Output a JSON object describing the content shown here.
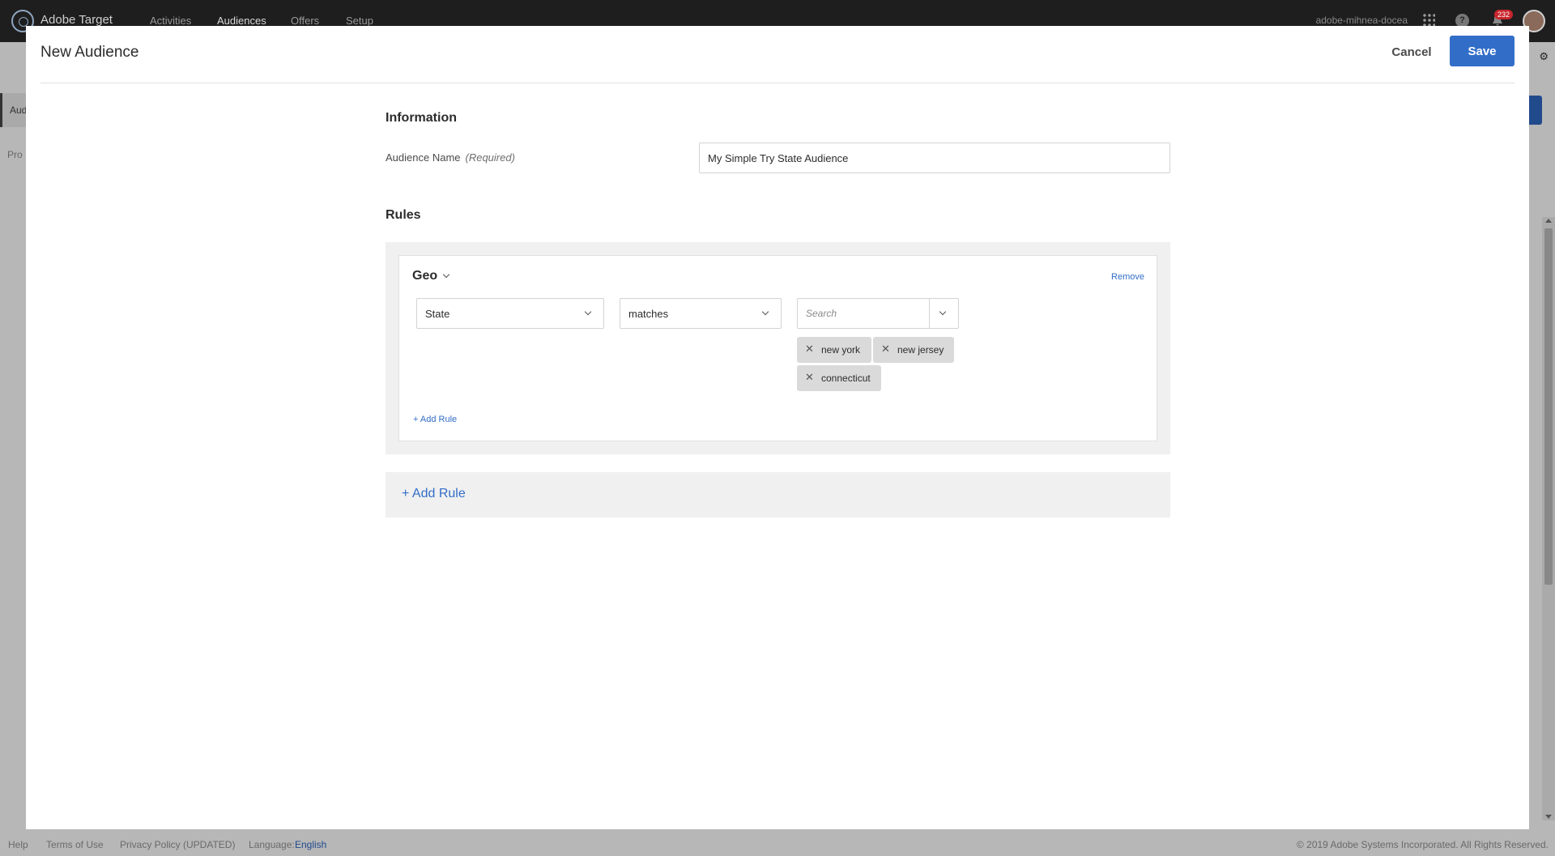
{
  "app": {
    "brand": "Adobe Target",
    "nav": [
      "Activities",
      "Audiences",
      "Offers",
      "Setup"
    ],
    "user": "adobe-mihnea-docea",
    "notification_count": "232",
    "side_items": [
      "Aud",
      "Pro"
    ]
  },
  "modal": {
    "title": "New Audience",
    "cancel_label": "Cancel",
    "save_label": "Save",
    "information_title": "Information",
    "audience_name_label": "Audience Name",
    "required_label": "(Required)",
    "audience_name_value": "My Simple Try State Audience",
    "rules_title": "Rules",
    "rule": {
      "category": "Geo",
      "remove_label": "Remove",
      "attribute": "State",
      "operator": "matches",
      "search_placeholder": "Search",
      "values": [
        "new york",
        "new jersey",
        "connecticut"
      ],
      "add_rule_label": "+ Add Rule"
    },
    "add_rule_label": "+ Add Rule"
  },
  "footer": {
    "help": "Help",
    "terms": "Terms of Use",
    "privacy": "Privacy Policy (UPDATED)",
    "language_label": "Language:",
    "language_value": "English",
    "copyright": "© 2019 Adobe Systems Incorporated. All Rights Reserved."
  },
  "colors": {
    "primary": "#326ec8",
    "topbar": "#1e1e1e",
    "badge": "#c9252c"
  }
}
